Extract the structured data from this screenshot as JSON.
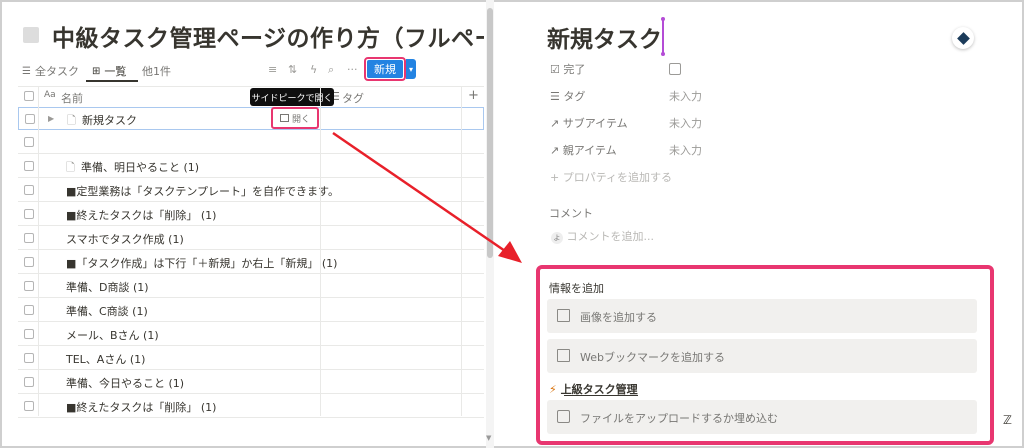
{
  "left": {
    "page_title": "中級タスク管理ページの作り方（フルペー",
    "views": {
      "all": "全タスク",
      "list": "一覧",
      "more": "他1件"
    },
    "new_button": "新規",
    "tooltip": "サイドピークで開く",
    "headers": {
      "name": "名前",
      "tag": "タグ"
    },
    "open_button": "開く",
    "rows": [
      "新規タスク",
      "",
      "準備、明日やること (1)",
      "■定型業務は「タスクテンプレート」を自作できます。",
      "■終えたタスクは「削除」 (1)",
      "スマホでタスク作成 (1)",
      "■「タスク作成」は下行「＋新規」か右上「新規」 (1)",
      "準備、D商談 (1)",
      "準備、C商談 (1)",
      "メール、Bさん (1)",
      "TEL、Aさん (1)",
      "準備、今日やること (1)",
      "■終えたタスクは「削除」 (1)"
    ]
  },
  "right": {
    "title": "新規タスク",
    "properties": [
      {
        "label": "完了",
        "value": ""
      },
      {
        "label": "タグ",
        "value": "未入力"
      },
      {
        "label": "サブアイテム",
        "value": "未入力"
      },
      {
        "label": "親アイテム",
        "value": "未入力"
      }
    ],
    "add_property": "プロパティを追加する",
    "comment_label": "コメント",
    "comment_placeholder": "コメントを追加...",
    "info_title": "情報を追加",
    "add_image": "画像を追加する",
    "add_bookmark": "Webブックマークを追加する",
    "template_link": "上級タスク管理",
    "upload": "ファイルをアップロードするか埋め込む"
  },
  "annotation_color": "#e83670"
}
